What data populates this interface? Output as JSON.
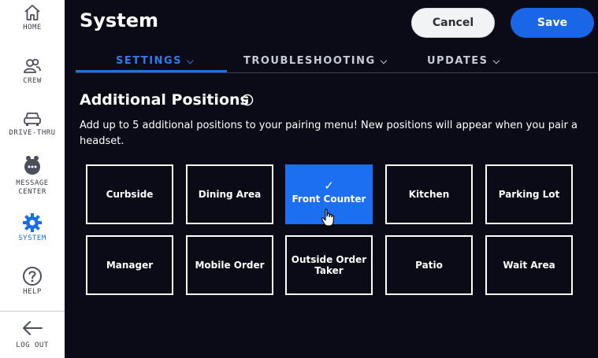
{
  "sidebar": {
    "items": [
      {
        "label": "HOME",
        "icon": "home-icon"
      },
      {
        "label": "CREW",
        "icon": "crew-icon"
      },
      {
        "label": "DRIVE-THRU",
        "icon": "car-icon"
      },
      {
        "label": "MESSAGE CENTER",
        "icon": "message-icon"
      },
      {
        "label": "SYSTEM",
        "icon": "gear-icon",
        "active": true
      },
      {
        "label": "HELP",
        "icon": "help-icon"
      },
      {
        "label": "LOG OUT",
        "icon": "arrow-left-icon"
      }
    ]
  },
  "header": {
    "title": "System",
    "cancel_label": "Cancel",
    "save_label": "Save"
  },
  "tabs": [
    {
      "label": "SETTINGS",
      "active": true
    },
    {
      "label": "TROUBLESHOOTING",
      "active": false
    },
    {
      "label": "UPDATES",
      "active": false
    }
  ],
  "section": {
    "title": "Additional Positions",
    "description": "Add up to 5 additional positions to your pairing menu! New positions will appear when you pair a headset."
  },
  "positions": [
    {
      "label": "Curbside",
      "selected": false
    },
    {
      "label": "Dining Area",
      "selected": false
    },
    {
      "label": "Front Counter",
      "selected": true
    },
    {
      "label": "Kitchen",
      "selected": false
    },
    {
      "label": "Parking Lot",
      "selected": false
    },
    {
      "label": "Manager",
      "selected": false
    },
    {
      "label": "Mobile Order",
      "selected": false
    },
    {
      "label": "Outside Order Taker",
      "selected": false
    },
    {
      "label": "Patio",
      "selected": false
    },
    {
      "label": "Wait Area",
      "selected": false
    }
  ],
  "colors": {
    "accent": "#1d6ff2",
    "background": "#0a0b16",
    "sidebar_bg": "#ffffff",
    "active_tab": "#2d7bf0"
  }
}
